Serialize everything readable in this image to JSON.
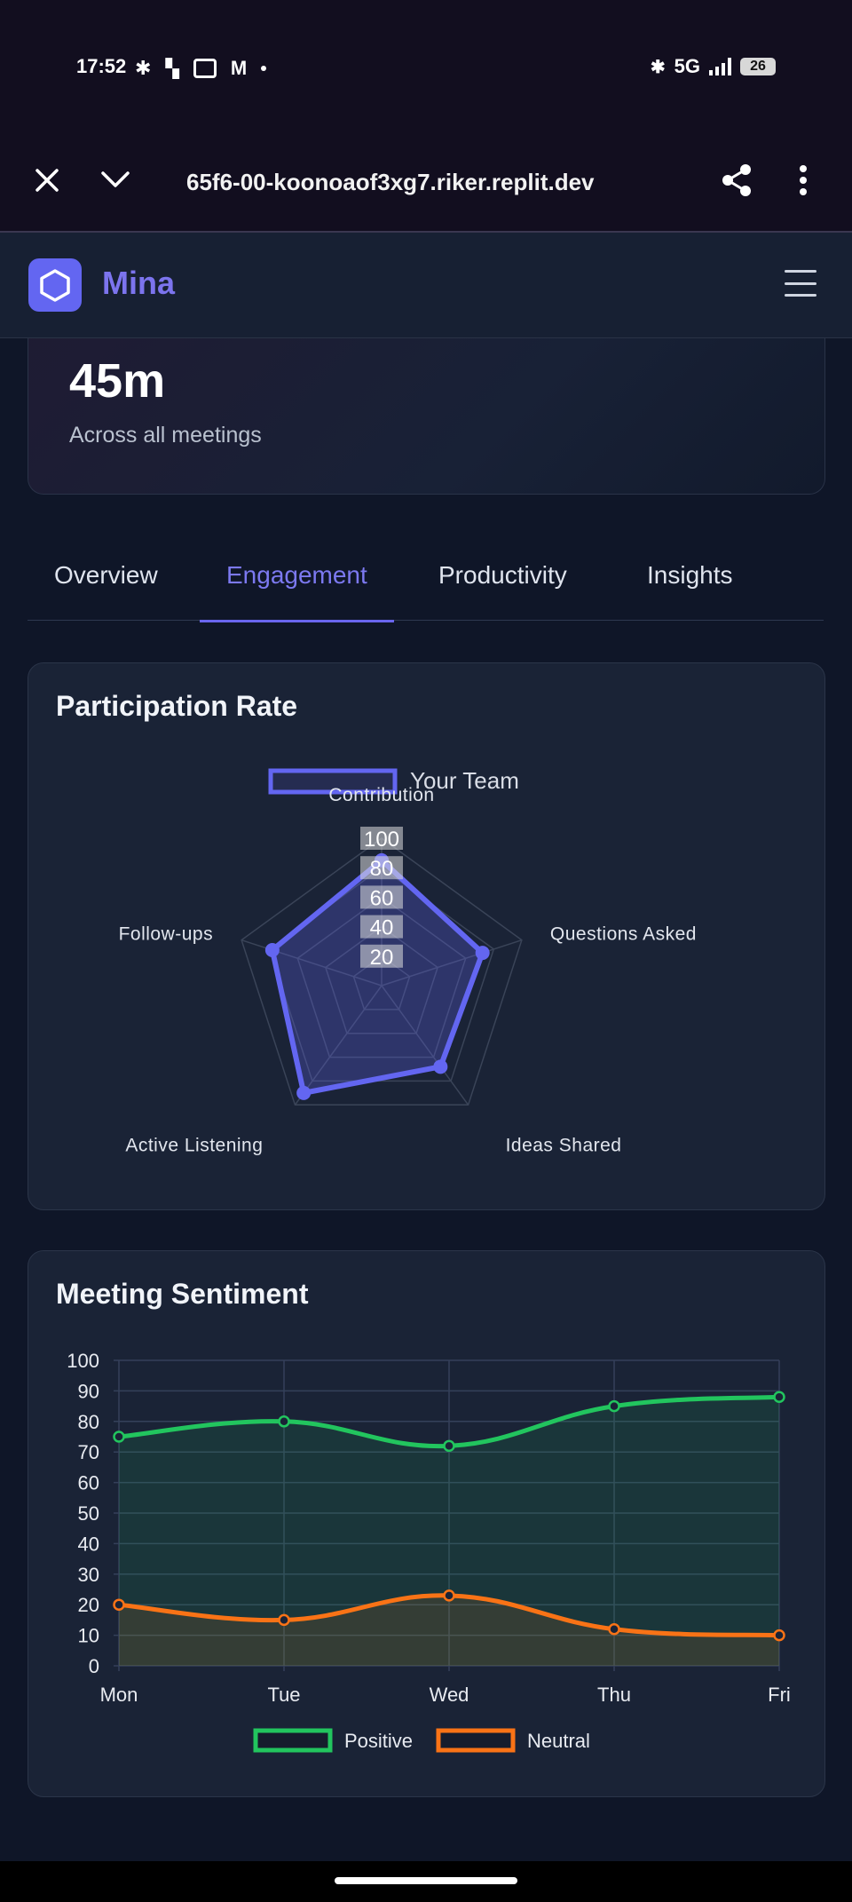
{
  "status_bar": {
    "time": "17:52",
    "network": "5G",
    "battery": "26"
  },
  "browser": {
    "url": "65f6-00-koonoaof3xg7.riker.replit.dev"
  },
  "app": {
    "name": "Mina"
  },
  "stat": {
    "value": "45m",
    "subtitle": "Across all meetings"
  },
  "tabs": [
    {
      "label": "Overview"
    },
    {
      "label": "Engagement"
    },
    {
      "label": "Productivity"
    },
    {
      "label": "Insights"
    }
  ],
  "active_tab": "Engagement",
  "colors": {
    "accent": "#6366f1",
    "positive": "#22c55e",
    "neutral": "#f97316"
  },
  "participation": {
    "title": "Participation Rate"
  },
  "sentiment": {
    "title": "Meeting Sentiment"
  },
  "chart_data": [
    {
      "type": "radar",
      "title": "Participation Rate",
      "categories": [
        "Contribution",
        "Questions Asked",
        "Ideas Shared",
        "Active Listening",
        "Follow-ups"
      ],
      "series": [
        {
          "name": "Your Team",
          "values": [
            85,
            72,
            68,
            90,
            78
          ]
        }
      ],
      "ticks": [
        "20",
        "40",
        "60",
        "80",
        "100"
      ],
      "r_range": [
        0,
        100
      ],
      "legend": "top"
    },
    {
      "type": "area",
      "title": "Meeting Sentiment",
      "categories": [
        "Mon",
        "Tue",
        "Wed",
        "Thu",
        "Fri"
      ],
      "series": [
        {
          "name": "Positive",
          "values": [
            75,
            80,
            72,
            85,
            88
          ]
        },
        {
          "name": "Neutral",
          "values": [
            20,
            15,
            23,
            12,
            10
          ]
        }
      ],
      "y_ticks": [
        "0",
        "10",
        "20",
        "30",
        "40",
        "50",
        "60",
        "70",
        "80",
        "90",
        "100"
      ],
      "ylim": [
        0,
        100
      ],
      "grid": true,
      "legend": "bottom"
    }
  ]
}
